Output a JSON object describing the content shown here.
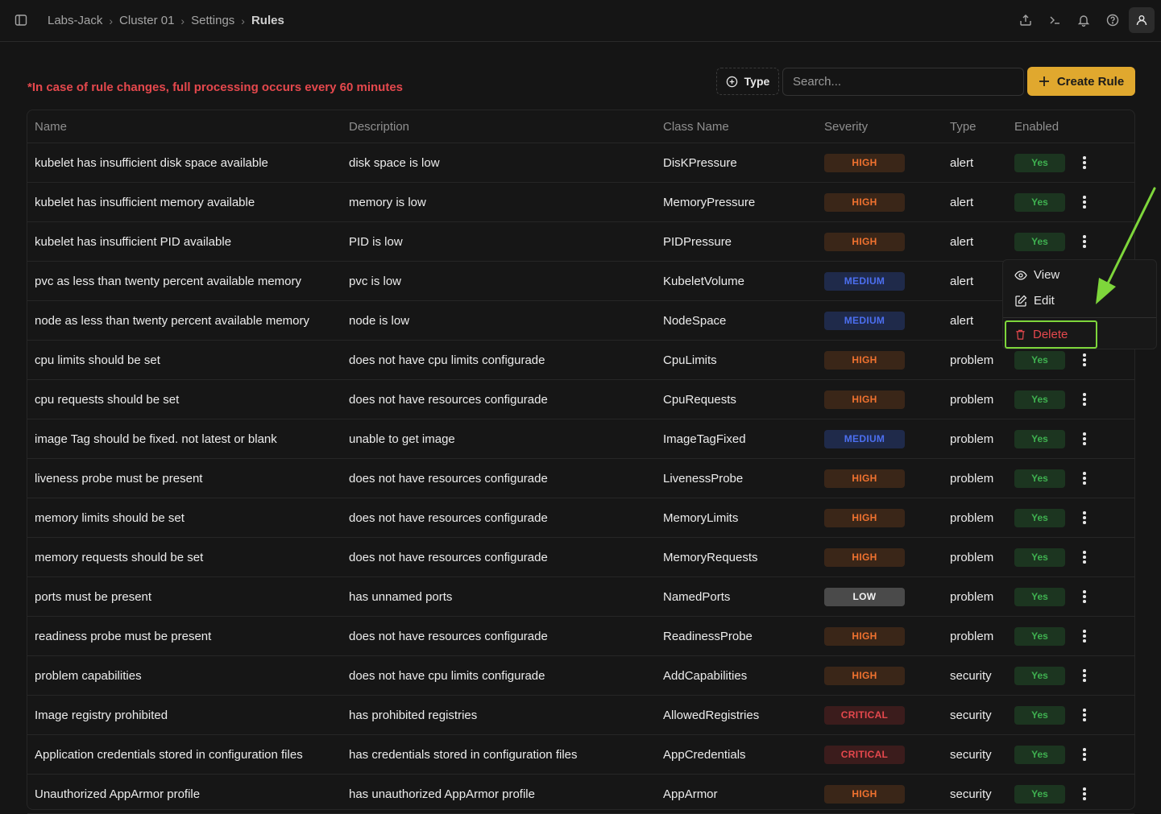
{
  "breadcrumb": [
    "Labs-Jack",
    "Cluster 01",
    "Settings",
    "Rules"
  ],
  "notice": "*In case of rule changes, full processing occurs every 60 minutes",
  "toolbar": {
    "type_label": "Type",
    "search_placeholder": "Search...",
    "create_label": "Create Rule"
  },
  "columns": {
    "name": "Name",
    "description": "Description",
    "class_name": "Class Name",
    "severity": "Severity",
    "type": "Type",
    "enabled": "Enabled"
  },
  "rows": [
    {
      "name": "kubelet has insufficient disk space available",
      "description": "disk space is low",
      "class_name": "DisKPressure",
      "severity": "HIGH",
      "type": "alert",
      "enabled": "Yes"
    },
    {
      "name": "kubelet has insufficient memory available",
      "description": "memory is low",
      "class_name": "MemoryPressure",
      "severity": "HIGH",
      "type": "alert",
      "enabled": "Yes"
    },
    {
      "name": "kubelet has insufficient PID available",
      "description": "PID is low",
      "class_name": "PIDPressure",
      "severity": "HIGH",
      "type": "alert",
      "enabled": "Yes"
    },
    {
      "name": "pvc as less than twenty percent available memory",
      "description": "pvc is low",
      "class_name": "KubeletVolume",
      "severity": "MEDIUM",
      "type": "alert",
      "enabled": ""
    },
    {
      "name": "node as less than twenty percent available memory",
      "description": "node is low",
      "class_name": "NodeSpace",
      "severity": "MEDIUM",
      "type": "alert",
      "enabled": ""
    },
    {
      "name": "cpu limits should be set",
      "description": "does not have cpu limits configurade",
      "class_name": "CpuLimits",
      "severity": "HIGH",
      "type": "problem",
      "enabled": "Yes"
    },
    {
      "name": "cpu requests should be set",
      "description": "does not have resources configurade",
      "class_name": "CpuRequests",
      "severity": "HIGH",
      "type": "problem",
      "enabled": "Yes"
    },
    {
      "name": "image Tag should be fixed. not latest or blank",
      "description": "unable to get image",
      "class_name": "ImageTagFixed",
      "severity": "MEDIUM",
      "type": "problem",
      "enabled": "Yes"
    },
    {
      "name": "liveness probe must be present",
      "description": "does not have resources configurade",
      "class_name": "LivenessProbe",
      "severity": "HIGH",
      "type": "problem",
      "enabled": "Yes"
    },
    {
      "name": "memory limits should be set",
      "description": "does not have resources configurade",
      "class_name": "MemoryLimits",
      "severity": "HIGH",
      "type": "problem",
      "enabled": "Yes"
    },
    {
      "name": "memory requests should be set",
      "description": "does not have resources configurade",
      "class_name": "MemoryRequests",
      "severity": "HIGH",
      "type": "problem",
      "enabled": "Yes"
    },
    {
      "name": "ports must be present",
      "description": "has unnamed ports",
      "class_name": "NamedPorts",
      "severity": "LOW",
      "type": "problem",
      "enabled": "Yes"
    },
    {
      "name": "readiness probe must be present",
      "description": "does not have resources configurade",
      "class_name": "ReadinessProbe",
      "severity": "HIGH",
      "type": "problem",
      "enabled": "Yes"
    },
    {
      "name": "problem capabilities",
      "description": "does not have cpu limits configurade",
      "class_name": "AddCapabilities",
      "severity": "HIGH",
      "type": "security",
      "enabled": "Yes"
    },
    {
      "name": "Image registry prohibited",
      "description": "has prohibited registries",
      "class_name": "AllowedRegistries",
      "severity": "CRITICAL",
      "type": "security",
      "enabled": "Yes"
    },
    {
      "name": "Application credentials stored in configuration files",
      "description": "has credentials stored in configuration files",
      "class_name": "AppCredentials",
      "severity": "CRITICAL",
      "type": "security",
      "enabled": "Yes"
    },
    {
      "name": "Unauthorized AppArmor profile",
      "description": "has unauthorized AppArmor profile",
      "class_name": "AppArmor",
      "severity": "HIGH",
      "type": "security",
      "enabled": "Yes"
    }
  ],
  "context_menu": {
    "view": "View",
    "edit": "Edit",
    "delete": "Delete"
  },
  "colors": {
    "accent": "#e0a82e",
    "danger": "#e5484d",
    "success": "#3fb150",
    "highlight": "#7ed63b"
  }
}
